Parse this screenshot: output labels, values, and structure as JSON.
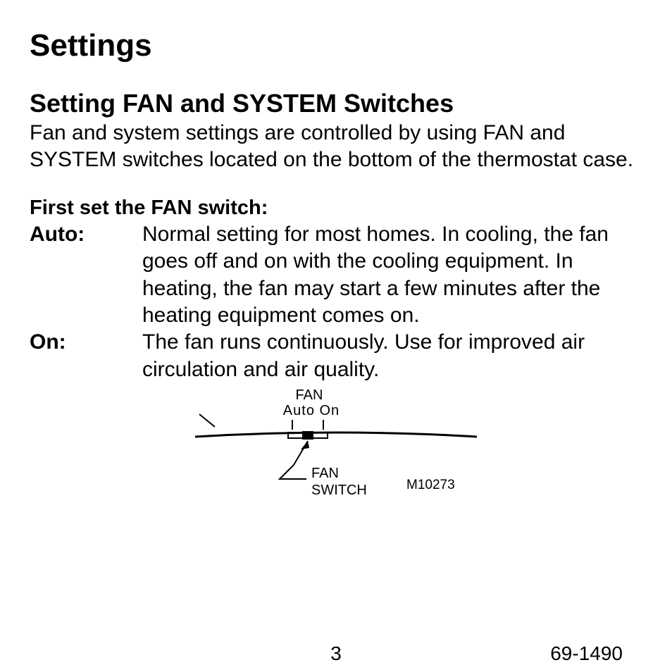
{
  "title": "Settings",
  "section": "Setting FAN and SYSTEM Switches",
  "intro": "Fan and system settings are controlled by using FAN and SYSTEM switches located on the bottom of the thermostat case.",
  "subhead": "First set the FAN switch:",
  "items": [
    {
      "term": "Auto:",
      "desc": "Normal setting for most homes. In cooling, the fan goes off and on with the cooling equipment. In heating, the fan may start a few minutes after the heating equipment comes on."
    },
    {
      "term": "On:",
      "desc": "The fan runs continuously. Use for improved air circulation and air quality."
    }
  ],
  "fig": {
    "top_label": "FAN",
    "positions": "Auto On",
    "pointer_label": "FAN\nSWITCH",
    "code": "M10273"
  },
  "page_number": "3",
  "doc_number": "69-1490"
}
